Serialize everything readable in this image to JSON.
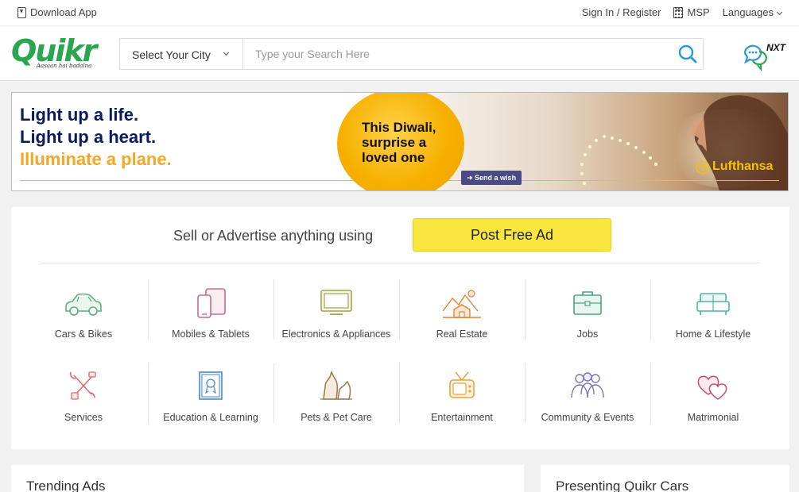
{
  "topbar": {
    "download_app": "Download App",
    "signin": "Sign In / Register",
    "msp": "MSP",
    "languages": "Languages"
  },
  "header": {
    "logo_text": "Quikr",
    "logo_tagline": "Aasaan hai badalna",
    "city_label": "Select Your City",
    "search_placeholder": "Type your Search Here",
    "nxt_label": "NXT"
  },
  "banner": {
    "line1": "Light up a life.",
    "line2": "Light up a heart.",
    "line3": "Illuminate a plane.",
    "circle_text": "This Diwali, surprise a loved one",
    "cta": "Send a wish",
    "brand": "Lufthansa"
  },
  "post_ad": {
    "prompt": "Sell or Advertise anything using",
    "button": "Post Free Ad"
  },
  "categories": [
    {
      "label": "Cars & Bikes",
      "icon": "car-icon",
      "color": "#5fae7d"
    },
    {
      "label": "Mobiles & Tablets",
      "icon": "mobile-tablet-icon",
      "color": "#c66a8f"
    },
    {
      "label": "Electronics & Appliances",
      "icon": "tv-icon",
      "color": "#a3a34c"
    },
    {
      "label": "Real Estate",
      "icon": "house-icon",
      "color": "#e0843a"
    },
    {
      "label": "Jobs",
      "icon": "briefcase-icon",
      "color": "#4aa57a"
    },
    {
      "label": "Home & Lifestyle",
      "icon": "sofa-icon",
      "color": "#4cb4a5"
    },
    {
      "label": "Services",
      "icon": "tools-icon",
      "color": "#e06a6a"
    },
    {
      "label": "Education & Learning",
      "icon": "certificate-icon",
      "color": "#4b8ac2"
    },
    {
      "label": "Pets & Pet Care",
      "icon": "pets-icon",
      "color": "#9b7a4a"
    },
    {
      "label": "Entertainment",
      "icon": "retro-tv-icon",
      "color": "#e3a63a"
    },
    {
      "label": "Community & Events",
      "icon": "people-icon",
      "color": "#7a74b8"
    },
    {
      "label": "Matrimonial",
      "icon": "hearts-icon",
      "color": "#c84e6a"
    }
  ],
  "sections": {
    "trending": "Trending Ads",
    "cars": "Presenting Quikr Cars"
  },
  "colors": {
    "brand_green": "#2aa650",
    "post_button": "#fbe63d",
    "search_icon": "#2a9ad4"
  }
}
